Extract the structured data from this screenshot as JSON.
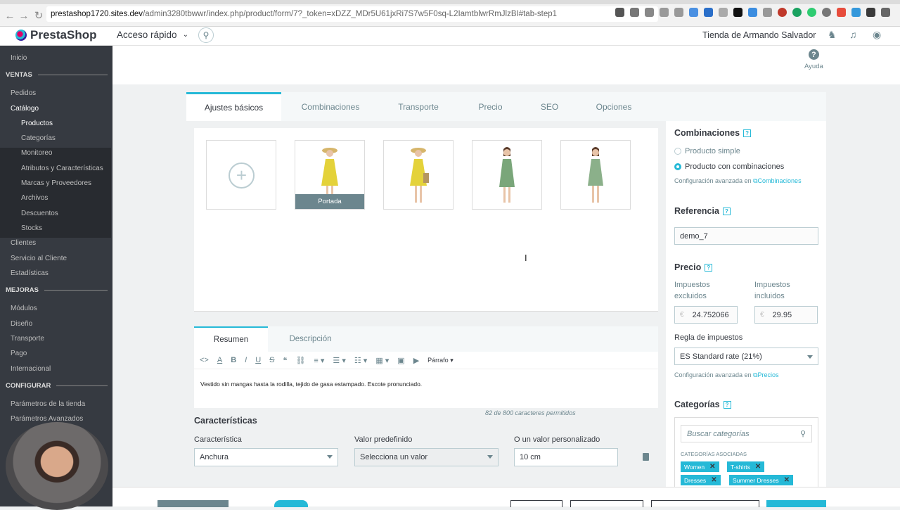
{
  "browser": {
    "url_host": "prestashop1720.sites.dev",
    "url_rest": "/admin3280tbwwr/index.php/product/form/7?_token=xDZZ_MDr5U61jxRi7S7w5F0sq-L2IamtblwrRmJlzBI#tab-step1"
  },
  "header": {
    "logo": "PrestaShop",
    "quick_access": "Acceso rápido",
    "shop_name": "Tienda de Armando Salvador"
  },
  "sidebar": {
    "home": "Inicio",
    "section_sales": "VENTAS",
    "orders": "Pedidos",
    "catalog": "Catálogo",
    "catalog_items": [
      "Productos",
      "Categorías",
      "Monitoreo",
      "Atributos y Características",
      "Marcas y Proveedores",
      "Archivos",
      "Descuentos",
      "Stocks"
    ],
    "customers": "Clientes",
    "customer_service": "Servicio al Cliente",
    "stats": "Estadísticas",
    "section_improve": "MEJORAS",
    "improve_items": [
      "Módulos",
      "Diseño",
      "Transporte",
      "Pago",
      "Internacional"
    ],
    "section_configure": "CONFIGURAR",
    "configure_items": [
      "Parámetros de la tienda",
      "Parámetros Avanzados"
    ]
  },
  "help": {
    "label": "Ayuda"
  },
  "tabs": [
    "Ajustes básicos",
    "Combinaciones",
    "Transporte",
    "Precio",
    "SEO",
    "Opciones"
  ],
  "images": {
    "cover_label": "Portada"
  },
  "description": {
    "tabs": [
      "Resumen",
      "Descripción"
    ],
    "paragraph_label": "Párrafo",
    "summary_text": "Vestido sin mangas hasta la rodilla, tejido de gasa estampado. Escote pronunciado.",
    "char_count": "82 de 800 caracteres permitidos"
  },
  "features": {
    "title": "Características",
    "label_feature": "Característica",
    "label_predefined": "Valor predefinido",
    "label_custom": "O un valor personalizado",
    "feature_value": "Anchura",
    "predefined_value": "Selecciona un valor",
    "custom_value": "10 cm"
  },
  "right": {
    "combinations_title": "Combinaciones",
    "simple_product": "Producto simple",
    "with_combinations": "Producto con combinaciones",
    "advanced_config": "Configuración avanzada en",
    "combinations_link": "Combinaciones",
    "reference_title": "Referencia",
    "reference_value": "demo_7",
    "price_title": "Precio",
    "tax_excl": "Impuestos excluidos",
    "tax_incl": "Impuestos incluidos",
    "currency": "€",
    "price_excl": "24.752066",
    "price_incl": "29.95",
    "tax_rule_label": "Regla de impuestos",
    "tax_rule_value": "ES Standard rate (21%)",
    "prices_link": "Precios",
    "categories_title": "Categorías",
    "search_categories": "Buscar categorías",
    "assoc_categories": "CATEGORÍAS ASOCIADAS",
    "chips": [
      "Women",
      "T-shirts",
      "Dresses",
      "Summer Dresses"
    ]
  },
  "colors": {
    "accent": "#25b9d7",
    "sidebar": "#363a41",
    "muted": "#6c868e"
  }
}
